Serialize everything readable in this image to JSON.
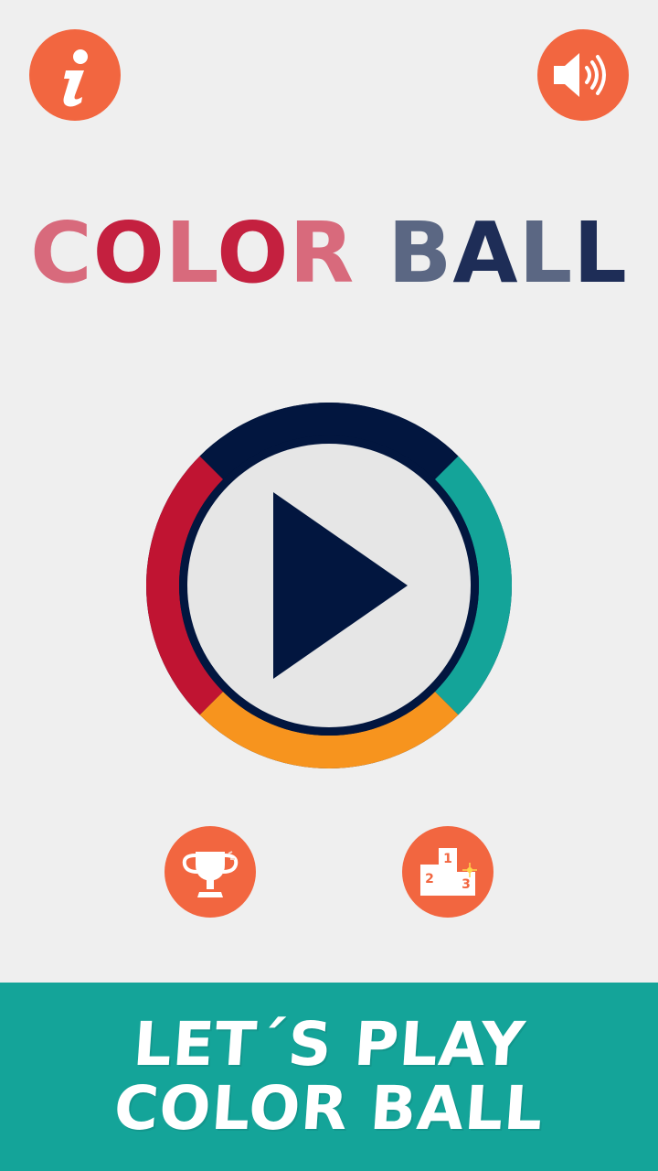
{
  "title": {
    "word1": "COLOR",
    "word2": "BALL",
    "word1_letters": [
      {
        "ch": "C",
        "color": "#d86a7c"
      },
      {
        "ch": "O",
        "color": "#c4203f"
      },
      {
        "ch": "L",
        "color": "#d86a7c"
      },
      {
        "ch": "O",
        "color": "#c4203f"
      },
      {
        "ch": "R",
        "color": "#d86a7c"
      }
    ],
    "word2_letters": [
      {
        "ch": "B",
        "color": "#5b6783"
      },
      {
        "ch": "A",
        "color": "#1e2d57"
      },
      {
        "ch": "L",
        "color": "#5b6783"
      },
      {
        "ch": "L",
        "color": "#1e2d57"
      }
    ]
  },
  "buttons": {
    "info_icon": "info-icon",
    "sound_icon": "speaker-icon",
    "trophy_icon": "trophy-icon",
    "leaderboard_icon": "podium-icon",
    "leaderboard_ranks": [
      "1",
      "2",
      "3"
    ]
  },
  "play_ring": {
    "colors": {
      "top": "#02163f",
      "right": "#14a499",
      "bottom": "#f7941e",
      "left": "#c01432",
      "inner": "#e6e6e6",
      "play": "#02163f"
    }
  },
  "banner": {
    "line1": "LET´S PLAY",
    "line2": "COLOR BALL"
  },
  "colors": {
    "background": "#efefef",
    "button": "#f26640",
    "banner": "#14a499"
  }
}
